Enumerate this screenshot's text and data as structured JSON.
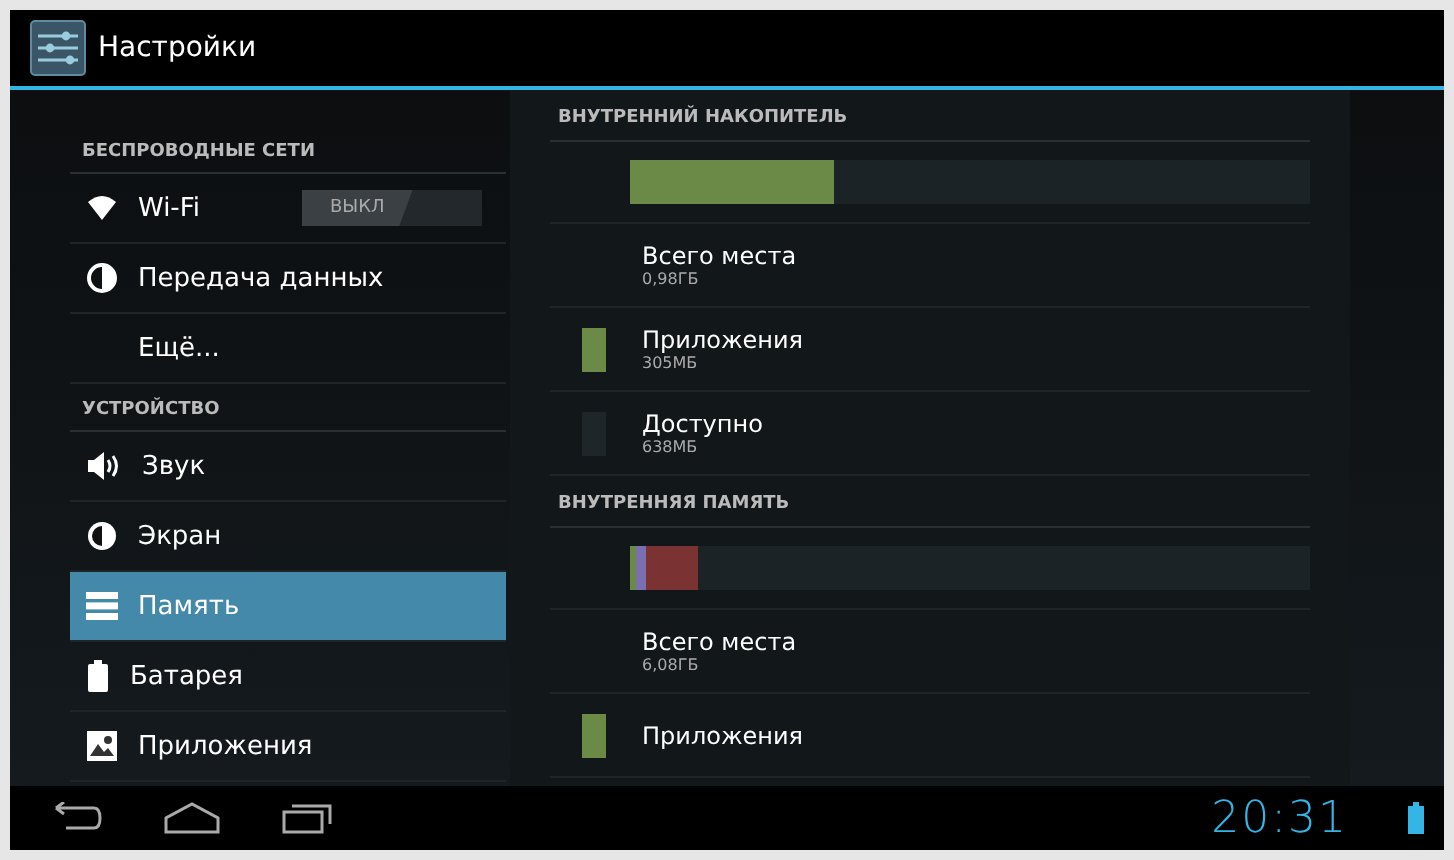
{
  "action_bar": {
    "title": "Настройки"
  },
  "sidebar": {
    "sections": [
      {
        "header": "БЕСПРОВОДНЫЕ СЕТИ",
        "items": [
          {
            "label": "Wi-Fi",
            "kind": "wifi",
            "selected": false,
            "toggle": {
              "label": "ВЫКЛ",
              "on": false
            }
          },
          {
            "label": "Передача данных",
            "kind": "data",
            "selected": false
          },
          {
            "label": "Ещё...",
            "kind": "plain",
            "selected": false
          }
        ]
      },
      {
        "header": "УСТРОЙСТВО",
        "items": [
          {
            "label": "Звук",
            "kind": "sound",
            "selected": false
          },
          {
            "label": "Экран",
            "kind": "display",
            "selected": false
          },
          {
            "label": "Память",
            "kind": "storage",
            "selected": true
          },
          {
            "label": "Батарея",
            "kind": "battery",
            "selected": false
          },
          {
            "label": "Приложения",
            "kind": "apps",
            "selected": false
          }
        ]
      }
    ]
  },
  "storage": [
    {
      "header": "ВНУТРЕННИЙ НАКОПИТЕЛЬ",
      "segments": [
        {
          "color": "#6b8a47",
          "level": 0.3
        }
      ],
      "rows": [
        {
          "title": "Всего места",
          "value": "0,98ГБ"
        },
        {
          "title": "Приложения",
          "value": "305МБ",
          "color": "#6b8a47"
        },
        {
          "title": "Доступно",
          "value": "638МБ",
          "color": "#1f2629"
        }
      ]
    },
    {
      "header": "ВНУТРЕННЯЯ ПАМЯТЬ",
      "segments": [
        {
          "color": "#6b8a47",
          "level": 0.008
        },
        {
          "color": "#7b6fb0",
          "level": 0.016
        },
        {
          "color": "#7a3232",
          "level": 0.075
        }
      ],
      "rows": [
        {
          "title": "Всего места",
          "value": "6,08ГБ"
        },
        {
          "title": "Приложения",
          "color": "#6b8a47"
        }
      ]
    }
  ],
  "system_bar": {
    "clock": "20:31"
  }
}
